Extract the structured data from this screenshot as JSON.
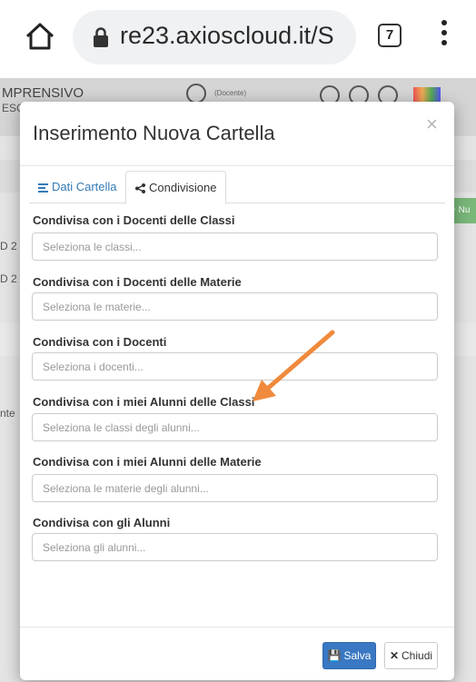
{
  "browser": {
    "url": "re23.axioscloud.it/S",
    "tab_count": "7",
    "home_icon": "home-icon",
    "lock_icon": "lock-icon",
    "menu_icon": "kebab-menu-icon"
  },
  "background": {
    "school_name": "MPRENSIVO",
    "school_name_2": "ESC",
    "user_role": "(Docente)",
    "row_text_1": "D 2",
    "row_text_2": "D 2",
    "row_text_3": "nte",
    "new_button": "+ Nu"
  },
  "modal": {
    "title": "Inserimento Nuova Cartella",
    "close": "×",
    "tabs": [
      {
        "label": "Dati Cartella",
        "icon": "list-icon",
        "active": false
      },
      {
        "label": "Condivisione",
        "icon": "share-icon",
        "active": true
      }
    ],
    "fields": [
      {
        "label": "Condivisa con i Docenti delle Classi",
        "placeholder": "Seleziona le classi..."
      },
      {
        "label": "Condivisa con i Docenti delle Materie",
        "placeholder": "Seleziona le materie..."
      },
      {
        "label": "Condivisa con i Docenti",
        "placeholder": "Seleziona i docenti..."
      },
      {
        "label": "Condivisa con i miei Alunni delle Classi",
        "placeholder": "Seleziona le classi degli alunni..."
      },
      {
        "label": "Condivisa con i miei Alunni delle Materie",
        "placeholder": "Seleziona le materie degli alunni..."
      },
      {
        "label": "Condivisa con gli Alunni",
        "placeholder": "Seleziona gli alunni..."
      }
    ],
    "buttons": {
      "save": "Salva",
      "close": "Chiudi"
    }
  },
  "colors": {
    "primary": "#3a78c3",
    "annotation_arrow": "#f08a3c"
  }
}
